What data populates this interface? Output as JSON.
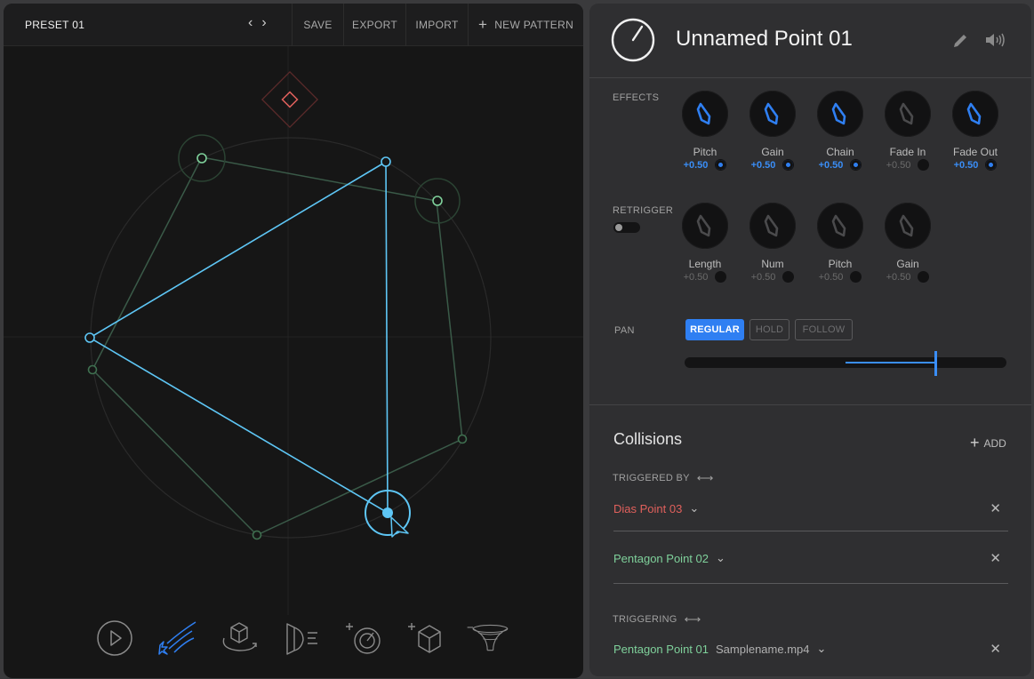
{
  "toolbar": {
    "preset": "PRESET 01",
    "prev": "‹",
    "next": "›",
    "save": "SAVE",
    "export": "EXPORT",
    "import": "IMPORT",
    "new_pattern": "NEW PATTERN",
    "plus": "+"
  },
  "tools": [
    "play-icon",
    "shooting-star-icon",
    "rotate-cube-icon",
    "face-sound-icon",
    "add-speed-icon",
    "add-cube-icon",
    "vortex-icon"
  ],
  "colors": {
    "accent": "#3a8ef7",
    "cyan": "#5ec6f5",
    "green": "#7fd19b",
    "dim_green": "#3a5a48",
    "red": "#e0605c"
  },
  "point": {
    "title": "Unnamed Point 01",
    "icon": "dial-icon"
  },
  "effects": {
    "label": "EFFECTS",
    "knobs": [
      {
        "name": "Pitch",
        "value": "+0.50",
        "active": true
      },
      {
        "name": "Gain",
        "value": "+0.50",
        "active": true
      },
      {
        "name": "Chain",
        "value": "+0.50",
        "active": true
      },
      {
        "name": "Fade In",
        "value": "+0.50",
        "active": false
      },
      {
        "name": "Fade Out",
        "value": "+0.50",
        "active": true
      }
    ]
  },
  "retrigger": {
    "label": "RETRIGGER",
    "knobs": [
      {
        "name": "Length",
        "value": "+0.50",
        "active": false
      },
      {
        "name": "Num",
        "value": "+0.50",
        "active": false
      },
      {
        "name": "Pitch",
        "value": "+0.50",
        "active": false
      },
      {
        "name": "Gain",
        "value": "+0.50",
        "active": false
      }
    ]
  },
  "pan": {
    "label": "PAN",
    "modes": [
      "REGULAR",
      "HOLD",
      "FOLLOW"
    ],
    "selected": "REGULAR",
    "level": 0.78
  },
  "collisions": {
    "title": "Collisions",
    "add": "ADD",
    "triggered_by_label": "TRIGGERED BY",
    "triggered_by": [
      {
        "name": "Dias Point 03",
        "color": "#e0605c"
      },
      {
        "name": "Pentagon Point 02",
        "color": "#7fd19b"
      }
    ],
    "triggering_label": "TRIGGERING",
    "triggering": [
      {
        "name": "Pentagon Point 01",
        "sample": "Samplename.mp4",
        "color": "#7fd19b"
      }
    ]
  }
}
